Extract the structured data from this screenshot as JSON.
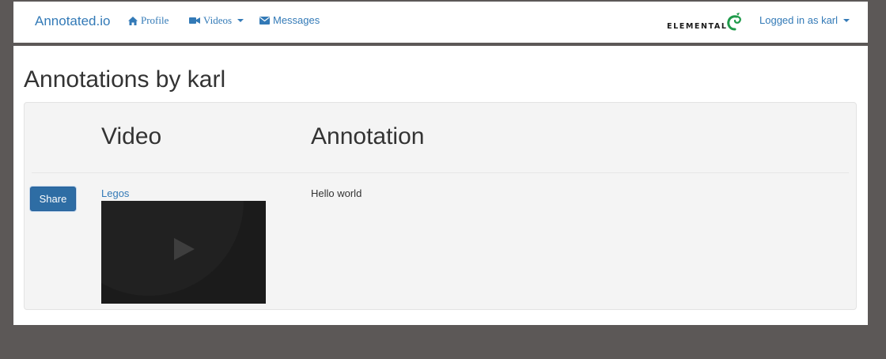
{
  "navbar": {
    "brand": "Annotated.io",
    "items": [
      {
        "label": "Profile",
        "icon": "home-icon"
      },
      {
        "label": "Videos",
        "icon": "video-camera-icon"
      },
      {
        "label": "Messages",
        "icon": "envelope-icon"
      }
    ],
    "logo_text": "ELEMENTAL",
    "user_menu": "Logged in as karl"
  },
  "page": {
    "title": "Annotations by karl"
  },
  "table": {
    "headers": [
      "Video",
      "Annotation"
    ],
    "rows": [
      {
        "share_label": "Share",
        "video_title": "Legos",
        "annotation": "Hello world"
      }
    ]
  },
  "colors": {
    "link": "#337ab7",
    "button": "#2e6da4",
    "page_bg": "#5c5857",
    "well_bg": "#f4f4f4",
    "logo_green": "#1f9a4a"
  }
}
